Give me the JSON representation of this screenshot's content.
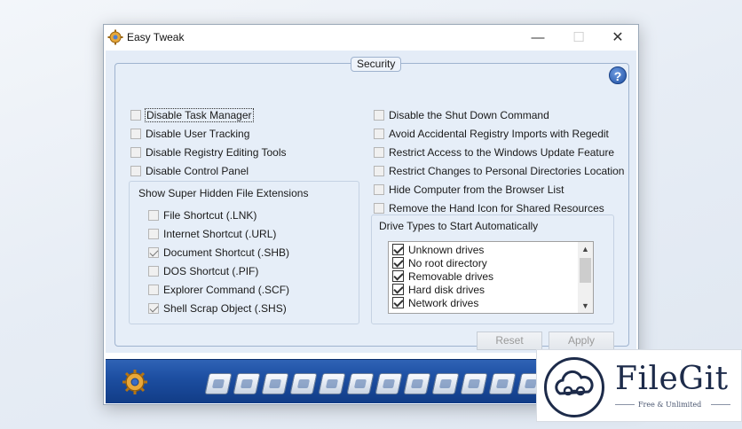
{
  "window": {
    "title": "Easy Tweak",
    "controls": {
      "minimize": "—",
      "maximize": "☐",
      "close": "✕"
    }
  },
  "panel": {
    "caption": "Security",
    "help": "?"
  },
  "left_options": [
    {
      "label": "Disable Task Manager",
      "checked": false,
      "focused": true
    },
    {
      "label": "Disable User Tracking",
      "checked": false
    },
    {
      "label": "Disable Registry Editing Tools",
      "checked": false
    },
    {
      "label": "Disable Control Panel",
      "checked": false
    }
  ],
  "extensions": {
    "heading": "Show Super Hidden File Extensions",
    "items": [
      {
        "label": "File Shortcut (.LNK)",
        "checked": false
      },
      {
        "label": "Internet Shortcut (.URL)",
        "checked": false
      },
      {
        "label": "Document Shortcut (.SHB)",
        "checked": true
      },
      {
        "label": "DOS Shortcut (.PIF)",
        "checked": false
      },
      {
        "label": "Explorer Command (.SCF)",
        "checked": false
      },
      {
        "label": "Shell Scrap Object (.SHS)",
        "checked": true
      }
    ]
  },
  "right_options": [
    {
      "label": "Disable the Shut Down Command",
      "checked": false
    },
    {
      "label": "Avoid Accidental Registry Imports with Regedit",
      "checked": false
    },
    {
      "label": "Restrict Access to the Windows Update Feature",
      "checked": false
    },
    {
      "label": "Restrict Changes to Personal Directories Location",
      "checked": false
    },
    {
      "label": "Hide Computer from the Browser List",
      "checked": false
    },
    {
      "label": "Remove the Hand Icon for Shared Resources",
      "checked": false
    }
  ],
  "drives": {
    "heading": "Drive Types to Start Automatically",
    "items": [
      {
        "label": "Unknown drives",
        "checked": true
      },
      {
        "label": "No root directory",
        "checked": true
      },
      {
        "label": "Removable drives",
        "checked": true
      },
      {
        "label": "Hard disk drives",
        "checked": true
      },
      {
        "label": "Network drives",
        "checked": true
      }
    ]
  },
  "buttons": {
    "reset": "Reset",
    "apply": "Apply"
  },
  "toolbar": {
    "icons": [
      "settings-gear-icon",
      "globe-icon",
      "drive-icon",
      "display-icon",
      "pen-icon",
      "disc-icon",
      "window-icon",
      "folder-icon",
      "paint-icon",
      "envelope-icon",
      "gears-icon",
      "security-icon",
      "network-icon",
      "info-icon"
    ]
  },
  "watermark": {
    "title": "FileGit",
    "subtitle": "Free & Unlimited"
  },
  "colors": {
    "accent": "#1d4fa2",
    "panel_bg": "#e6eef8",
    "watermark": "#1d2b4a"
  }
}
